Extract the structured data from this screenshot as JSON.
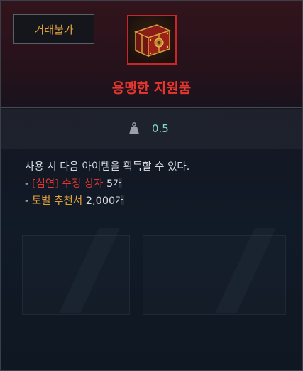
{
  "tooltip": {
    "trade_badge": "거래불가",
    "item_name": "용맹한 지원품",
    "weight": "0.5",
    "description": "사용 시 다음 아이템을 획득할 수 있다.",
    "rewards": [
      {
        "prefix": "- ",
        "name": "[심연] 수정 상자",
        "quantity": " 5개",
        "color": "#e8362e"
      },
      {
        "prefix": "- ",
        "name": "토벌 추천서",
        "quantity": " 2,000개",
        "color": "#e2a13a"
      }
    ],
    "icons": {
      "item": "treasure-chest-icon",
      "weight": "weight-icon"
    }
  },
  "colors": {
    "item_name": "#e8362e",
    "trade_badge": "#e2a13a",
    "weight_value": "#7fd6c8",
    "icon_border": "#c9262a"
  }
}
